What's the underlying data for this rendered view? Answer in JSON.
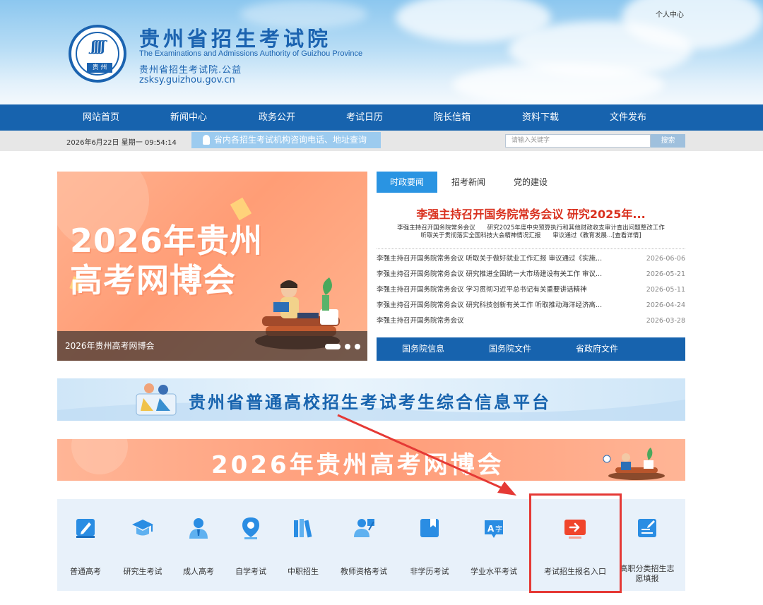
{
  "header": {
    "title": "贵州省招生考试院",
    "title_en": "The Examinations and Admissions Authority of Guizhou Province",
    "subtitle": "贵州省招生考试院.公益",
    "url": "zsksy.guizhou.gov.cn",
    "logo_text": "贵 州",
    "personal_center": "个人中心"
  },
  "nav": {
    "items": [
      "网站首页",
      "新闻中心",
      "政务公开",
      "考试日历",
      "院长信箱",
      "资料下载",
      "文件发布"
    ]
  },
  "infobar": {
    "datetime": "2026年6月22日 星期一 09:54:14",
    "notice": "省内各招生考试机构咨询电话、地址查询",
    "search_placeholder": "请输入关键字",
    "search_button": "搜索"
  },
  "banner": {
    "line1": "2026年贵州",
    "line2": "高考网博会",
    "caption": "2026年贵州高考网博会"
  },
  "news": {
    "tabs": [
      "时政要闻",
      "招考新闻",
      "党的建设"
    ],
    "headline": "李强主持召开国务院常务会议 研究2025年...",
    "summary_line1": "李强主持召开国务院常务会议　　研究2025年度中央预算执行和其他财政收支审计查出问题整改工作",
    "summary_line2": "听取关于贯彻落实全国科技大会精神情况汇报　　审议通过《教育发展...[查看详情]",
    "items": [
      {
        "title": "李强主持召开国务院常务会议 听取关于做好就业工作汇报 审议通过《实施...",
        "date": "2026-06-06"
      },
      {
        "title": "李强主持召开国务院常务会议 研究推进全国统一大市场建设有关工作 审议...",
        "date": "2026-05-21"
      },
      {
        "title": "李强主持召开国务院常务会议 学习贯彻习近平总书记有关重要讲话精神",
        "date": "2026-05-11"
      },
      {
        "title": "李强主持召开国务院常务会议 研究科技创新有关工作 听取推动海洋经济高...",
        "date": "2026-04-24"
      },
      {
        "title": "李强主持召开国务院常务会议",
        "date": "2026-03-28"
      }
    ],
    "links": [
      "国务院信息",
      "国务院文件",
      "省政府文件"
    ]
  },
  "platform_banner": "贵州省普通高校招生考试考生综合信息平台",
  "expo_banner": "2026年贵州高考网博会",
  "services": [
    {
      "label": "普通高考",
      "icon": "pencil-book-icon"
    },
    {
      "label": "研究生考试",
      "icon": "graduation-cap-icon"
    },
    {
      "label": "成人高考",
      "icon": "person-icon"
    },
    {
      "label": "自学考试",
      "icon": "location-pin-icon"
    },
    {
      "label": "中职招生",
      "icon": "books-icon"
    },
    {
      "label": "教师资格考试",
      "icon": "teacher-icon"
    },
    {
      "label": "非学历考试",
      "icon": "bookmark-icon"
    },
    {
      "label": "学业水平考试",
      "icon": "translate-icon"
    },
    {
      "label": "考试招生报名入口",
      "icon": "login-arrow-icon"
    },
    {
      "label": "高职分类招生志愿填报",
      "icon": "form-edit-icon"
    }
  ],
  "colors": {
    "brand_blue": "#1763ae",
    "accent_red": "#e53935",
    "headline_red": "#d9301e"
  }
}
